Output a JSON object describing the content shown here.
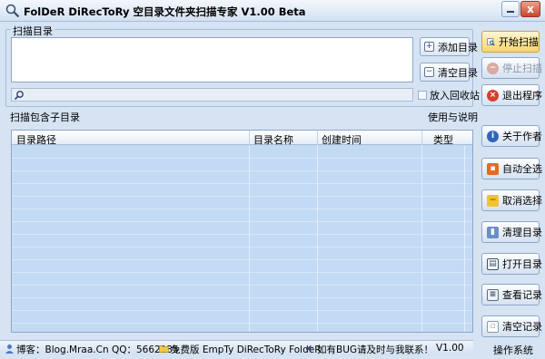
{
  "window": {
    "title": "FolDeR DiRecToRy 空目录文件夹扫描专家 V1.00 Beta",
    "close_glyph": "x"
  },
  "scan_group": {
    "label": "扫描目录",
    "add_label": "添加目录",
    "clear_label": "清空目录",
    "recycle_label": "放入回收站"
  },
  "sub_label": "扫描包含子目录",
  "help_label": "使用与说明",
  "table": {
    "columns": [
      "目录路径",
      "目录名称",
      "创建时间",
      "类型"
    ]
  },
  "side_buttons": {
    "start": "开始扫描",
    "stop": "停止扫描",
    "exit": "退出程序",
    "about": "关于作者",
    "select_all": "自动全选",
    "deselect": "取消选择",
    "clean": "清理目录",
    "open": "打开目录",
    "view_log": "查看记录",
    "clear_log": "清空记录"
  },
  "status": {
    "blog": "博客：Blog.Mraa.Cn QQ：5662135",
    "edition": "免费版 EmpTy DiRecToRy FoldeR",
    "bug": "如有BUG请及时与我联系！",
    "version": "V1.00",
    "os": "操作系统"
  },
  "colors": {
    "background": "#d6e3f3",
    "primary_button": "#f9d56d",
    "table_body": "#c3daf4"
  }
}
